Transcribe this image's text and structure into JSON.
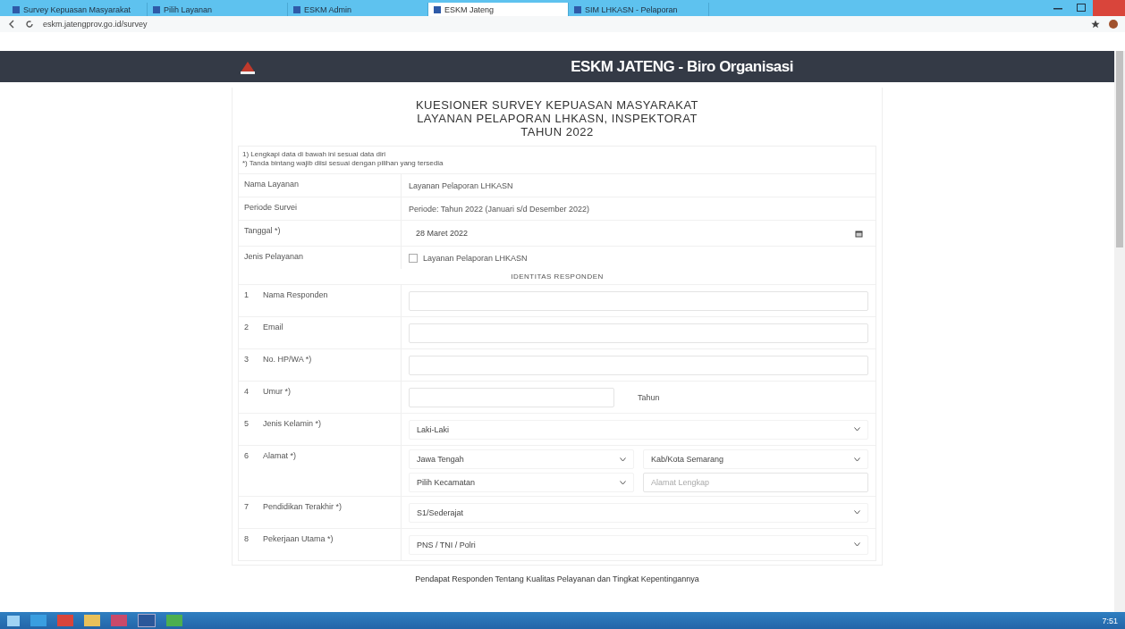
{
  "browser": {
    "tabs": [
      {
        "title": "Survey Kepuasan Masyarakat",
        "selected": false
      },
      {
        "title": "Pilih Layanan",
        "selected": false
      },
      {
        "title": "ESKM Admin",
        "selected": false
      },
      {
        "title": "ESKM Jateng",
        "selected": true
      },
      {
        "title": "SIM LHKASN - Pelaporan",
        "selected": false
      }
    ],
    "address": "eskm.jatengprov.go.id/survey"
  },
  "header": {
    "title": "ESKM JATENG - Biro Organisasi"
  },
  "form": {
    "title_lines": [
      "KUESIONER SURVEY KEPUASAN MASYARAKAT",
      "LAYANAN PELAPORAN LHKASN, INSPEKTORAT",
      "TAHUN 2022"
    ],
    "notes": [
      "1) Lengkapi data di bawah ini sesuai data diri",
      "*) Tanda bintang wajib diisi sesuai dengan pilihan yang tersedia"
    ],
    "info_rows": [
      {
        "kind": "text",
        "label": "Nama Layanan",
        "value": "Layanan Pelaporan LHKASN"
      },
      {
        "kind": "text",
        "label": "Periode Survei",
        "value": "Periode: Tahun 2022 (Januari s/d Desember 2022)"
      },
      {
        "kind": "date",
        "label": "Tanggal *)",
        "value": "28 Maret 2022"
      },
      {
        "kind": "checkbox",
        "label": "Jenis Pelayanan",
        "value": "Layanan Pelaporan LHKASN",
        "checked": false
      }
    ],
    "section_title": "IDENTITAS RESPONDEN",
    "questions": [
      {
        "number": "1",
        "label": "Nama Responden",
        "kind": "single",
        "fields": [
          {
            "kind": "input"
          }
        ]
      },
      {
        "number": "2",
        "label": "Email",
        "kind": "single",
        "fields": [
          {
            "kind": "input"
          }
        ]
      },
      {
        "number": "3",
        "label": "No. HP/WA *)",
        "kind": "single",
        "fields": [
          {
            "kind": "input"
          }
        ]
      },
      {
        "number": "4",
        "label": "Umur *)",
        "kind": "unit",
        "fields": [
          {
            "kind": "input"
          },
          {
            "kind": "unit",
            "value": "Tahun"
          }
        ]
      },
      {
        "number": "5",
        "label": "Jenis Kelamin *)",
        "kind": "single",
        "fields": [
          {
            "kind": "select",
            "value": "Laki-Laki"
          }
        ]
      },
      {
        "number": "6",
        "label": "Alamat *)",
        "kind": "grid",
        "fields": [
          {
            "kind": "select",
            "value": "Jawa Tengah"
          },
          {
            "kind": "select",
            "value": "Kab/Kota Semarang"
          },
          {
            "kind": "select",
            "value": "Pilih Kecamatan"
          },
          {
            "kind": "input",
            "placeholder": "Alamat Lengkap"
          }
        ]
      },
      {
        "number": "7",
        "label": "Pendidikan Terakhir *)",
        "kind": "single",
        "fields": [
          {
            "kind": "select",
            "value": "S1/Sederajat"
          }
        ]
      },
      {
        "number": "8",
        "label": "Pekerjaan Utama *)",
        "kind": "single",
        "fields": [
          {
            "kind": "select",
            "value": "PNS / TNI / Polri"
          }
        ]
      }
    ]
  },
  "next_heading": "Pendapat Responden Tentang Kualitas Pelayanan dan Tingkat Kepentingannya",
  "taskbar": {
    "time": "7:51"
  }
}
